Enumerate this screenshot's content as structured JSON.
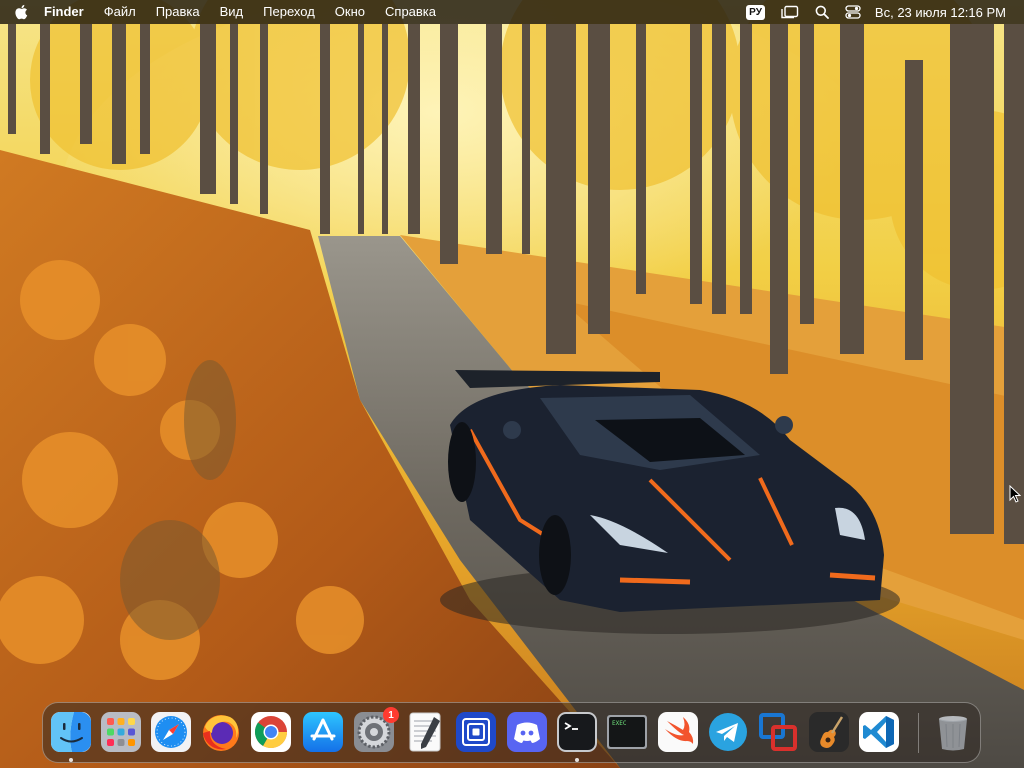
{
  "menubar": {
    "app_name": "Finder",
    "items": [
      "Файл",
      "Правка",
      "Вид",
      "Переход",
      "Окно",
      "Справка"
    ],
    "input_source": "РУ",
    "datetime": "Вс, 23 июля  12:16 PM"
  },
  "dock": {
    "apps": [
      {
        "name": "Finder",
        "icon": "finder-icon",
        "running": true
      },
      {
        "name": "Launchpad",
        "icon": "launchpad-icon",
        "running": false
      },
      {
        "name": "Safari",
        "icon": "safari-icon",
        "running": false
      },
      {
        "name": "Firefox",
        "icon": "firefox-icon",
        "running": false
      },
      {
        "name": "Google Chrome",
        "icon": "chrome-icon",
        "running": false
      },
      {
        "name": "App Store",
        "icon": "app-store-icon",
        "running": false
      },
      {
        "name": "System Settings",
        "icon": "system-settings-icon",
        "running": false,
        "badge": "1"
      },
      {
        "name": "TextEdit",
        "icon": "textedit-icon",
        "running": false
      },
      {
        "name": "Screens",
        "icon": "screens-icon",
        "running": false
      },
      {
        "name": "Discord",
        "icon": "discord-icon",
        "running": false
      },
      {
        "name": "Terminal",
        "icon": "terminal-icon",
        "running": true
      },
      {
        "name": "Console",
        "icon": "console-icon",
        "running": false,
        "label": "EXEC"
      },
      {
        "name": "Swift Playgrounds",
        "icon": "swift-icon",
        "running": false
      },
      {
        "name": "Telegram",
        "icon": "telegram-icon",
        "running": false
      },
      {
        "name": "Parallels",
        "icon": "parallels-icon",
        "running": false
      },
      {
        "name": "GarageBand",
        "icon": "garageband-icon",
        "running": false
      },
      {
        "name": "Visual Studio Code",
        "icon": "vscode-icon",
        "running": false
      },
      {
        "name": "Trash",
        "icon": "trash-icon",
        "running": false
      }
    ]
  },
  "colors": {
    "menubar_bg": "#1c160e",
    "badge_red": "#ff3b30",
    "wallpaper_foliage": "#e8a020",
    "wallpaper_trees": "#5a4e42",
    "car_body": "#1b2230",
    "car_accent": "#f06a1c"
  }
}
